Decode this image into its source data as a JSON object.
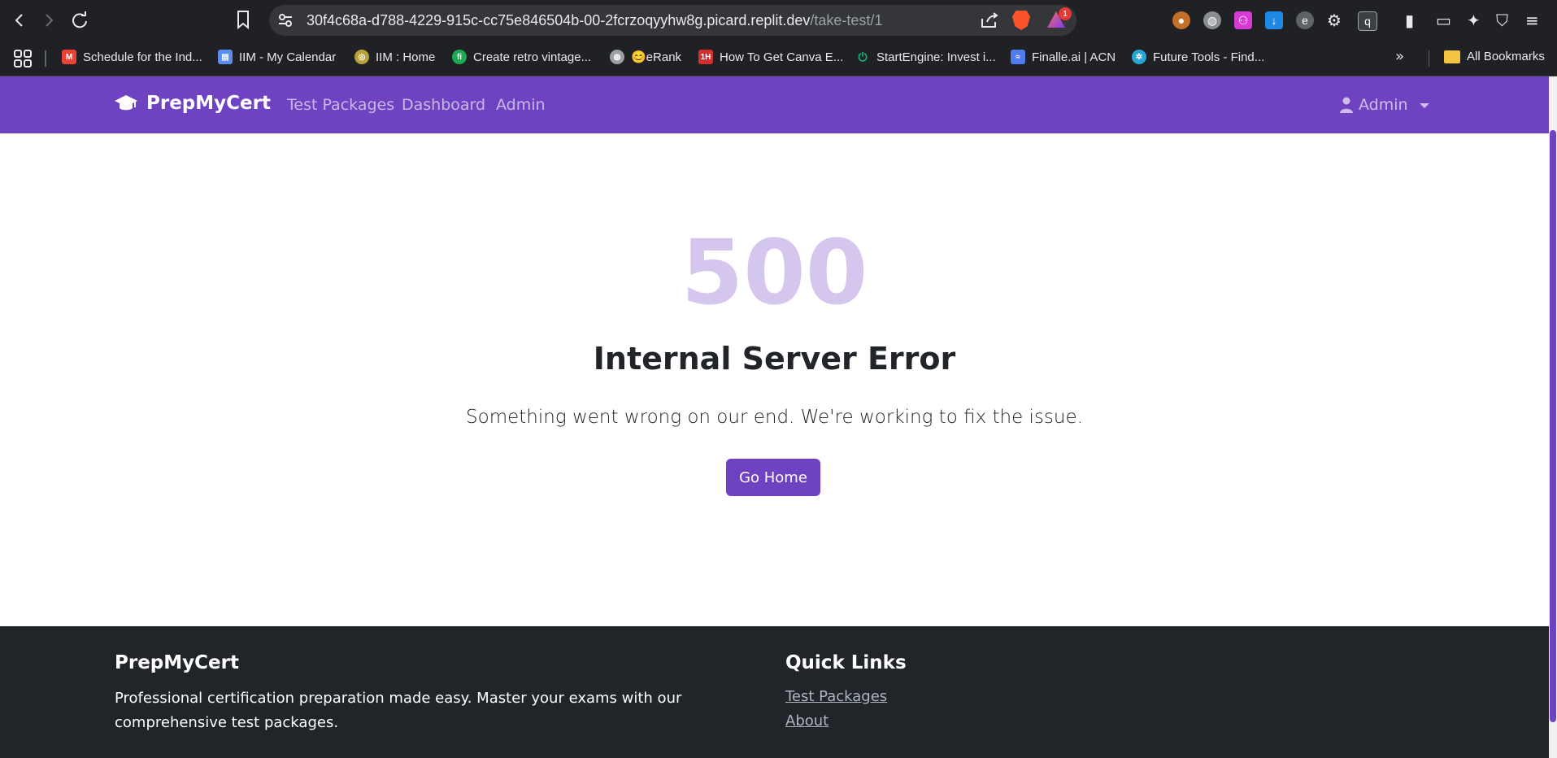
{
  "browser": {
    "url_host": "30f4c68a-d788-4229-915c-cc75e846504b-00-2fcrzoqyyhw8g.picard.replit.dev",
    "url_path": "/take-test/1",
    "rewards_badge": "1",
    "bookmarks": [
      {
        "label": "Schedule for the Ind...",
        "icon": "gmail-icon",
        "color": "#ea4335"
      },
      {
        "label": "IIM - My Calendar",
        "icon": "calendar-icon",
        "color": "#5b8def"
      },
      {
        "label": "IIM : Home",
        "icon": "iim-icon",
        "color": "#b8a23a"
      },
      {
        "label": "Create retro vintage...",
        "icon": "fi-icon",
        "color": "#1fa855"
      },
      {
        "label": "😊eRank",
        "icon": "globe-icon",
        "color": "#9aa0a6"
      },
      {
        "label": "How To Get Canva E...",
        "icon": "1h-icon",
        "color": "#d32f2f"
      },
      {
        "label": "StartEngine: Invest i...",
        "icon": "power-icon",
        "color": "#19b57a"
      },
      {
        "label": "Finalle.ai | ACN",
        "icon": "finalle-icon",
        "color": "#4f7df0"
      },
      {
        "label": "Future Tools - Find...",
        "icon": "futuretools-icon",
        "color": "#2aa6d6"
      }
    ],
    "all_bookmarks": "All Bookmarks"
  },
  "navbar": {
    "brand": "PrepMyCert",
    "links": [
      "Test Packages",
      "Dashboard",
      "Admin"
    ],
    "user": "Admin",
    "color": "#6f42c1"
  },
  "error": {
    "code": "500",
    "title": "Internal Server Error",
    "message": "Something went wrong on our end. We're working to fix the issue.",
    "button": "Go Home"
  },
  "footer": {
    "brand": "PrepMyCert",
    "description": "Professional certification preparation made easy. Master your exams with our comprehensive test packages.",
    "quick_links_title": "Quick Links",
    "links": [
      "Test Packages",
      "About"
    ]
  }
}
